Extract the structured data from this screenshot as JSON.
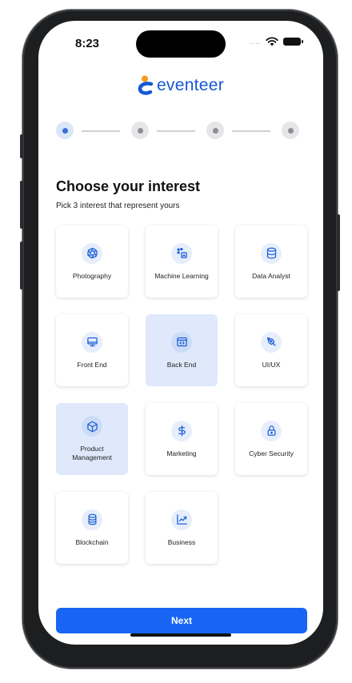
{
  "status_bar": {
    "time": "8:23",
    "dots": "....",
    "wifi_icon": "wifi-icon",
    "battery_icon": "battery-icon"
  },
  "brand": {
    "name": "eventeer",
    "logo_icon": "eventeer-logo-icon",
    "color": "#1557d6",
    "accent": "#f29b1d"
  },
  "stepper": {
    "total_steps": 4,
    "current_step": 1
  },
  "heading": {
    "title": "Choose your interest",
    "subtitle": "Pick 3 interest that represent yours"
  },
  "interests": [
    {
      "label": "Photography",
      "icon": "aperture-icon",
      "selected": false
    },
    {
      "label": "Machine Learning",
      "icon": "machine-learning-icon",
      "selected": false
    },
    {
      "label": "Data Analyst",
      "icon": "database-icon",
      "selected": false
    },
    {
      "label": "Front End",
      "icon": "monitor-icon",
      "selected": false
    },
    {
      "label": "Back End",
      "icon": "code-window-icon",
      "selected": true
    },
    {
      "label": "UI/UX",
      "icon": "pen-tool-icon",
      "selected": false
    },
    {
      "label": "Product Management",
      "icon": "box-icon",
      "selected": true
    },
    {
      "label": "Marketing",
      "icon": "dollar-icon",
      "selected": false
    },
    {
      "label": "Cyber Security",
      "icon": "lock-icon",
      "selected": false
    },
    {
      "label": "Blockchain",
      "icon": "blockchain-icon",
      "selected": false
    },
    {
      "label": "Business",
      "icon": "chart-icon",
      "selected": false
    }
  ],
  "colors": {
    "primary": "#1765f2",
    "selected_card": "#dfe9fb",
    "icon_blue": "#1a5fd8"
  },
  "actions": {
    "next_label": "Next"
  }
}
